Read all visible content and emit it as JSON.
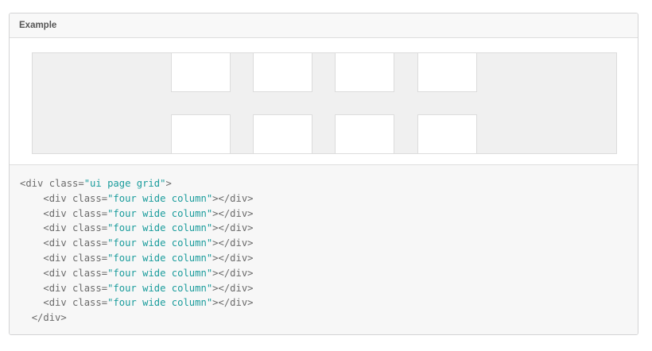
{
  "card": {
    "title": "Example"
  },
  "preview": {
    "rows": [
      [
        "",
        "",
        "",
        ""
      ],
      [
        "",
        "",
        "",
        ""
      ]
    ]
  },
  "code": {
    "lines": [
      {
        "indent": "",
        "open": "<div ",
        "attr": "class=",
        "value": "\"ui page grid\"",
        "close": ">"
      },
      {
        "indent": "    ",
        "open": "<div ",
        "attr": "class=",
        "value": "\"four wide column\"",
        "close": "></div>"
      },
      {
        "indent": "    ",
        "open": "<div ",
        "attr": "class=",
        "value": "\"four wide column\"",
        "close": "></div>"
      },
      {
        "indent": "    ",
        "open": "<div ",
        "attr": "class=",
        "value": "\"four wide column\"",
        "close": "></div>"
      },
      {
        "indent": "    ",
        "open": "<div ",
        "attr": "class=",
        "value": "\"four wide column\"",
        "close": "></div>"
      },
      {
        "indent": "    ",
        "open": "<div ",
        "attr": "class=",
        "value": "\"four wide column\"",
        "close": "></div>"
      },
      {
        "indent": "    ",
        "open": "<div ",
        "attr": "class=",
        "value": "\"four wide column\"",
        "close": "></div>"
      },
      {
        "indent": "    ",
        "open": "<div ",
        "attr": "class=",
        "value": "\"four wide column\"",
        "close": "></div>"
      },
      {
        "indent": "    ",
        "open": "<div ",
        "attr": "class=",
        "value": "\"four wide column\"",
        "close": "></div>"
      },
      {
        "indent": "  ",
        "open": "</div>",
        "attr": "",
        "value": "",
        "close": ""
      }
    ]
  },
  "colors": {
    "string": "#1a9c9c",
    "preview_bg": "#f0f0f0",
    "code_bg": "#f7f7f7"
  }
}
